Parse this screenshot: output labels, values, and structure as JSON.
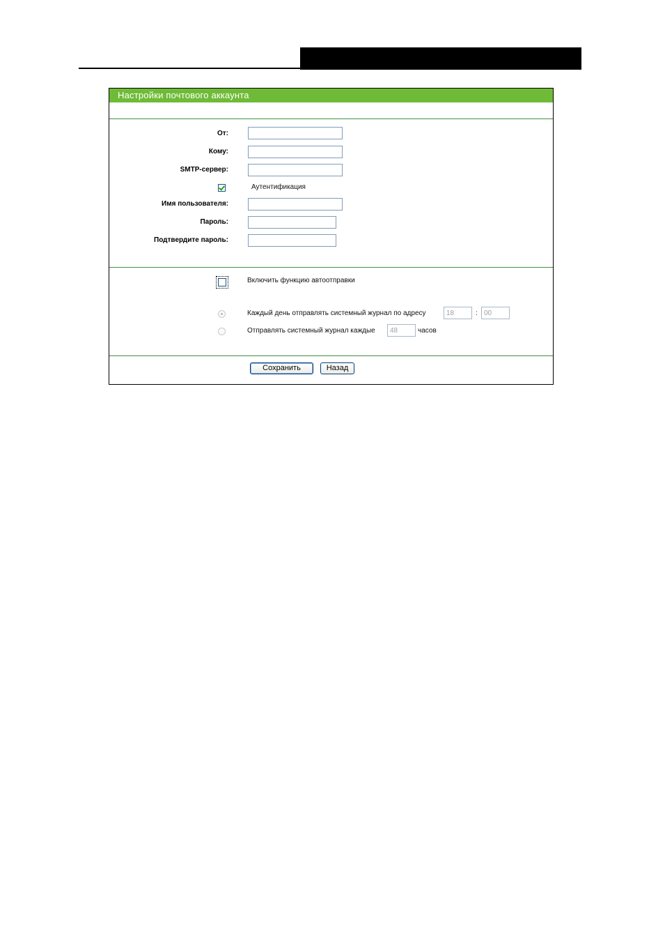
{
  "panel": {
    "title": "Настройки почтового аккаунта"
  },
  "account": {
    "from_label": "От:",
    "from_value": "",
    "to_label": "Кому:",
    "to_value": "",
    "smtp_label": "SMTP-сервер:",
    "smtp_value": "",
    "auth_label": "Аутентификация",
    "auth_checked": true,
    "username_label": "Имя пользователя:",
    "username_value": "",
    "password_label": "Пароль:",
    "password_value": "",
    "confirm_label": "Подтвердите пароль:",
    "confirm_value": ""
  },
  "autosend": {
    "enable_label": "Включить функцию автоотправки",
    "enable_checked": false,
    "daily_label": "Каждый день отправлять системный журнал по адресу",
    "daily_selected": true,
    "hour_value": "18",
    "time_separator": ":",
    "minute_value": "00",
    "interval_label": "Отправлять системный журнал каждые",
    "interval_selected": false,
    "interval_value": "48",
    "interval_unit": "часов"
  },
  "buttons": {
    "save": "Сохранить",
    "back": "Назад"
  },
  "colors": {
    "title_bar": "#6fbb37",
    "divider": "#3f8f3f"
  }
}
